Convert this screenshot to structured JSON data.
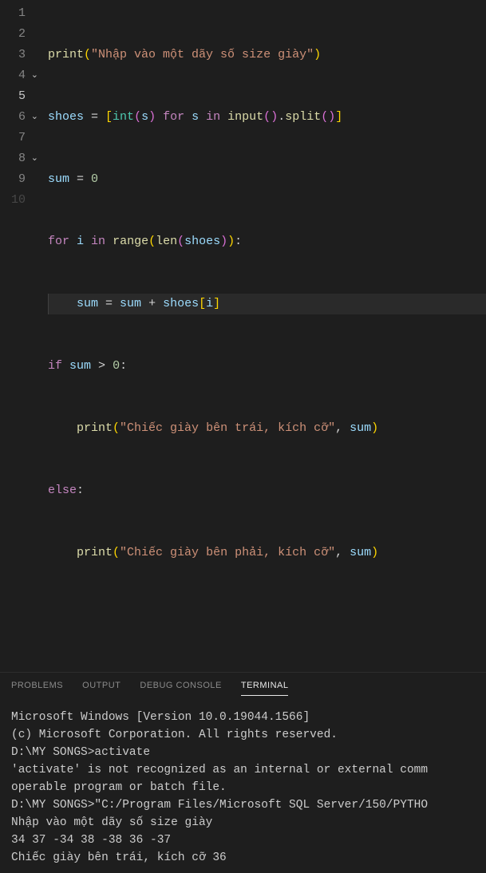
{
  "editor": {
    "lines": [
      {
        "num": "1",
        "fold": false,
        "active": false
      },
      {
        "num": "2",
        "fold": false,
        "active": false
      },
      {
        "num": "3",
        "fold": false,
        "active": false
      },
      {
        "num": "4",
        "fold": true,
        "active": false
      },
      {
        "num": "5",
        "fold": false,
        "active": true
      },
      {
        "num": "6",
        "fold": true,
        "active": false
      },
      {
        "num": "7",
        "fold": false,
        "active": false
      },
      {
        "num": "8",
        "fold": true,
        "active": false
      },
      {
        "num": "9",
        "fold": false,
        "active": false
      },
      {
        "num": "10",
        "fold": false,
        "active": false,
        "faded": true
      }
    ],
    "code": {
      "l1": {
        "fn": "print",
        "str": "\"Nhập vào một dãy số size giày\""
      },
      "l2": {
        "var1": "shoes",
        "eq": " = ",
        "lb": "[",
        "type": "int",
        "lp": "(",
        "v2": "s",
        "rp": ")",
        "kw1": " for ",
        "v3": "s",
        "kw2": " in ",
        "fn2": "input",
        "p2": "()",
        "dot": ".",
        "fn3": "split",
        "p3": "()",
        "rb": "]"
      },
      "l3": {
        "var": "sum",
        "eq": " = ",
        "num": "0"
      },
      "l4": {
        "kw": "for",
        "v": " i ",
        "kw2": "in",
        "sp": " ",
        "fn": "range",
        "lp": "(",
        "fn2": "len",
        "lp2": "(",
        "var": "shoes",
        "rp2": ")",
        "rp": ")",
        "col": ":"
      },
      "l5": {
        "var": "sum",
        "eq": " = ",
        "var2": "sum",
        "op": " + ",
        "var3": "shoes",
        "lb": "[",
        "idx": "i",
        "rb": "]"
      },
      "l6": {
        "kw": "if",
        "sp": " ",
        "var": "sum",
        "op": " > ",
        "num": "0",
        "col": ":"
      },
      "l7": {
        "fn": "print",
        "lp": "(",
        "str": "\"Chiếc giày bên trái, kích cỡ\"",
        "com": ", ",
        "var": "sum",
        "rp": ")"
      },
      "l8": {
        "kw": "else",
        "col": ":"
      },
      "l9": {
        "fn": "print",
        "lp": "(",
        "str": "\"Chiếc giày bên phải, kích cỡ\"",
        "com": ", ",
        "var": "sum",
        "rp": ")"
      }
    }
  },
  "panel": {
    "tabs": {
      "problems": "PROBLEMS",
      "output": "OUTPUT",
      "debug": "DEBUG CONSOLE",
      "terminal": "TERMINAL"
    },
    "terminal": {
      "t1": "Microsoft Windows [Version 10.0.19044.1566]",
      "t2": "(c) Microsoft Corporation. All rights reserved.",
      "t3": "",
      "t4": "D:\\MY SONGS>activate",
      "t5": "'activate' is not recognized as an internal or external comm",
      "t6": "operable program or batch file.",
      "t7": "",
      "t8": "D:\\MY SONGS>\"C:/Program Files/Microsoft SQL Server/150/PYTHO",
      "t9": "Nhập vào một dãy số size giày",
      "t10": "34 37 -34 38 -38 36 -37",
      "t11": "Chiếc giày bên trái, kích cỡ 36"
    }
  }
}
